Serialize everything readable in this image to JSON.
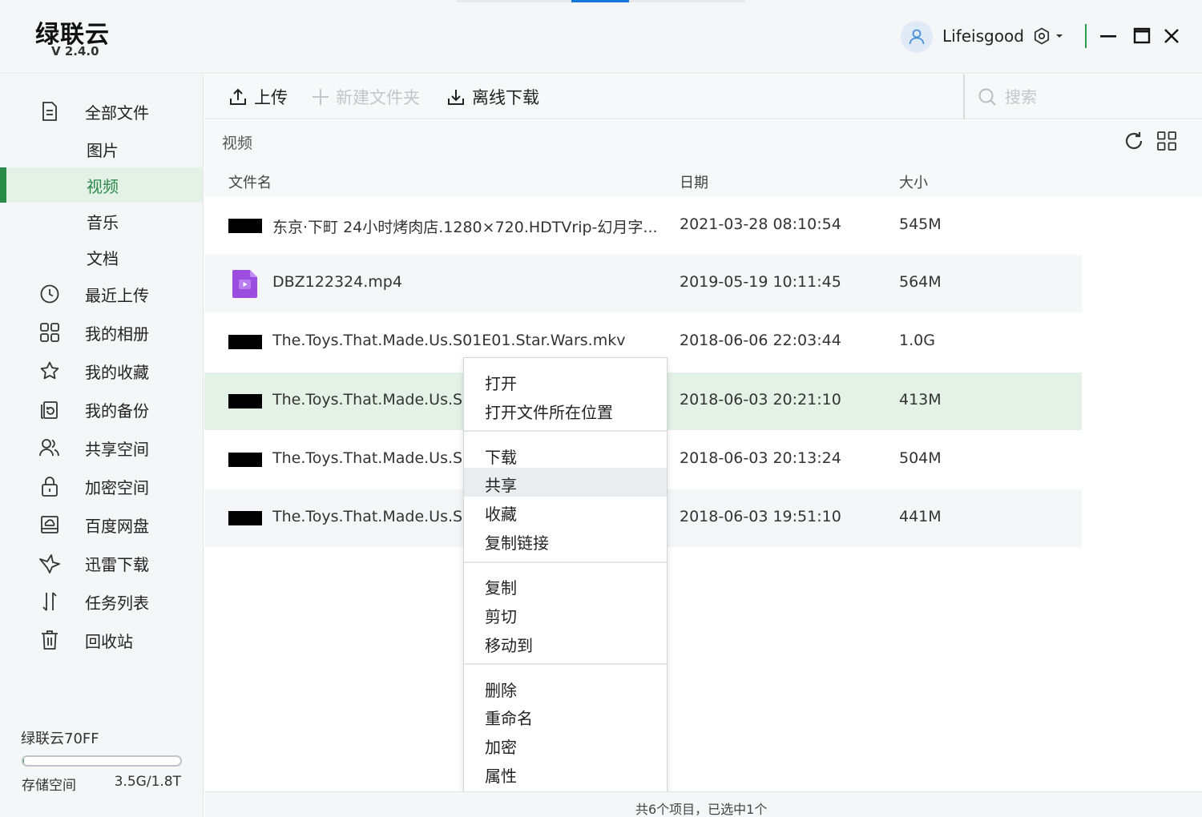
{
  "app": {
    "name": "绿联云",
    "version": "V 2.4.0"
  },
  "user": {
    "name": "Lifeisgood"
  },
  "sidebar": {
    "items": [
      {
        "label": "全部文件",
        "icon": "document-icon"
      },
      {
        "label": "图片"
      },
      {
        "label": "视频",
        "active": true
      },
      {
        "label": "音乐"
      },
      {
        "label": "文档"
      },
      {
        "label": "最近上传",
        "icon": "clock-icon"
      },
      {
        "label": "我的相册",
        "icon": "grid-icon"
      },
      {
        "label": "我的收藏",
        "icon": "star-icon"
      },
      {
        "label": "我的备份",
        "icon": "backup-icon"
      },
      {
        "label": "共享空间",
        "icon": "users-icon"
      },
      {
        "label": "加密空间",
        "icon": "lock-icon"
      },
      {
        "label": "百度网盘",
        "icon": "cloud-drive-icon"
      },
      {
        "label": "迅雷下载",
        "icon": "bird-icon"
      },
      {
        "label": "任务列表",
        "icon": "transfer-icon"
      },
      {
        "label": "回收站",
        "icon": "trash-icon"
      }
    ],
    "device": "绿联云70FF",
    "storage_label": "存储空间",
    "storage_value": "3.5G/1.8T",
    "storage_fraction": 0.002
  },
  "toolbar": {
    "upload": "上传",
    "new_folder": "新建文件夹",
    "offline_download": "离线下载",
    "search_placeholder": "搜索"
  },
  "breadcrumb": "视频",
  "table": {
    "columns": [
      "文件名",
      "日期",
      "大小"
    ],
    "rows": [
      {
        "name": "东京·下町 24小时烤肉店.1280×720.HDTVrip-幻月字...",
        "date": "2021-03-28 08:10:54",
        "size": "545M",
        "thumb": "black"
      },
      {
        "name": "DBZ122324.mp4",
        "date": "2019-05-19 10:11:45",
        "size": "564M",
        "thumb": "video-file-icon"
      },
      {
        "name": "The.Toys.That.Made.Us.S01E01.Star.Wars.mkv",
        "date": "2018-06-06 22:03:44",
        "size": "1.0G",
        "thumb": "black"
      },
      {
        "name": "The.Toys.That.Made.Us.S01E",
        "date": "2018-06-03 20:21:10",
        "size": "413M",
        "thumb": "black",
        "selected": true
      },
      {
        "name": "The.Toys.That.Made.Us.S01E",
        "date": "2018-06-03 20:13:24",
        "size": "504M",
        "thumb": "black"
      },
      {
        "name": "The.Toys.That.Made.Us.S01E",
        "date": "2018-06-03 19:51:10",
        "size": "441M",
        "thumb": "black"
      }
    ]
  },
  "context_menu": {
    "groups": [
      [
        "打开",
        "打开文件所在位置"
      ],
      [
        "下载",
        "共享",
        "收藏",
        "复制链接"
      ],
      [
        "复制",
        "剪切",
        "移动到"
      ],
      [
        "删除",
        "重命名",
        "加密",
        "属性"
      ]
    ],
    "hovered": "共享"
  },
  "status": "共6个项目，已选中1个",
  "colors": {
    "accent": "#2a8a48",
    "selected_row": "#e4f1e7",
    "tab_active": "#1677d9",
    "video_icon": "#9b4de0"
  }
}
